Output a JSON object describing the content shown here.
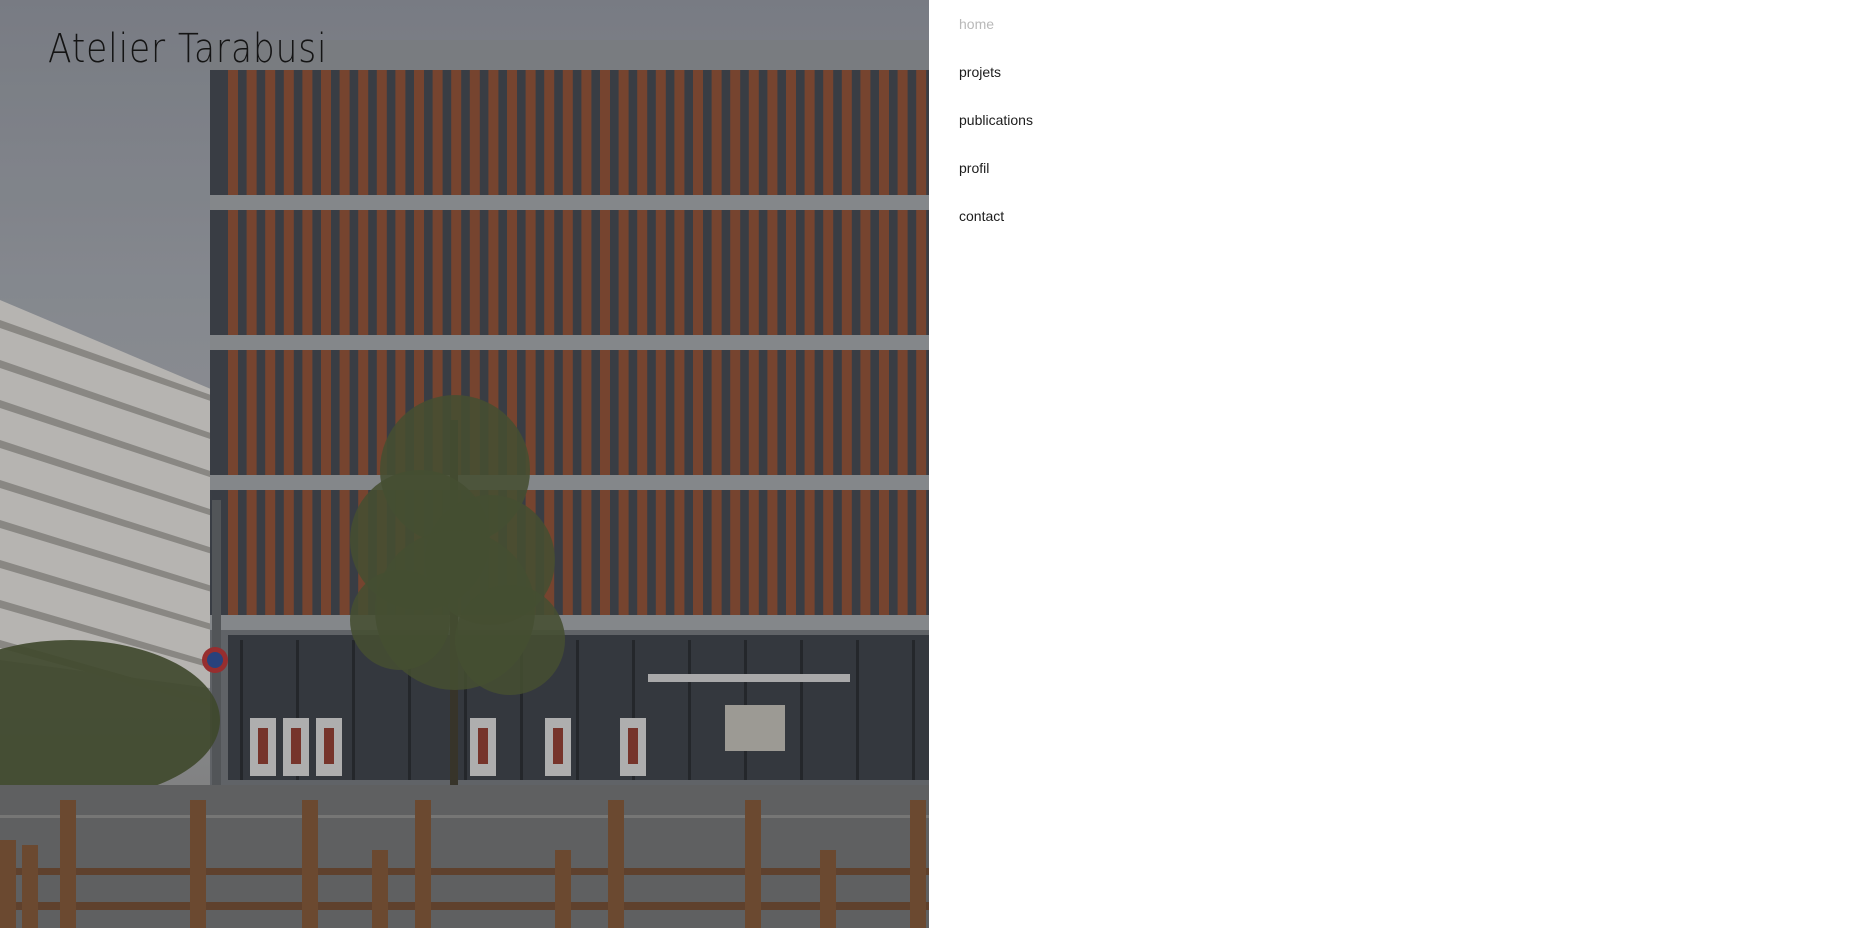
{
  "site": {
    "title": "Atelier Tarabusi"
  },
  "hero": {
    "image_alt": "Façade en bois d'un immeuble de bureaux"
  },
  "nav": {
    "items": [
      {
        "label": "home",
        "active": true
      },
      {
        "label": "projets",
        "active": false
      },
      {
        "label": "publications",
        "active": false
      },
      {
        "label": "profil",
        "active": false
      },
      {
        "label": "contact",
        "active": false
      }
    ]
  },
  "colors": {
    "background": "#ffffff",
    "title_text": "#141414",
    "nav_text": "#1c1c1c",
    "nav_active_text": "#b9b9b9",
    "facade_wood": "#8a4e32"
  }
}
